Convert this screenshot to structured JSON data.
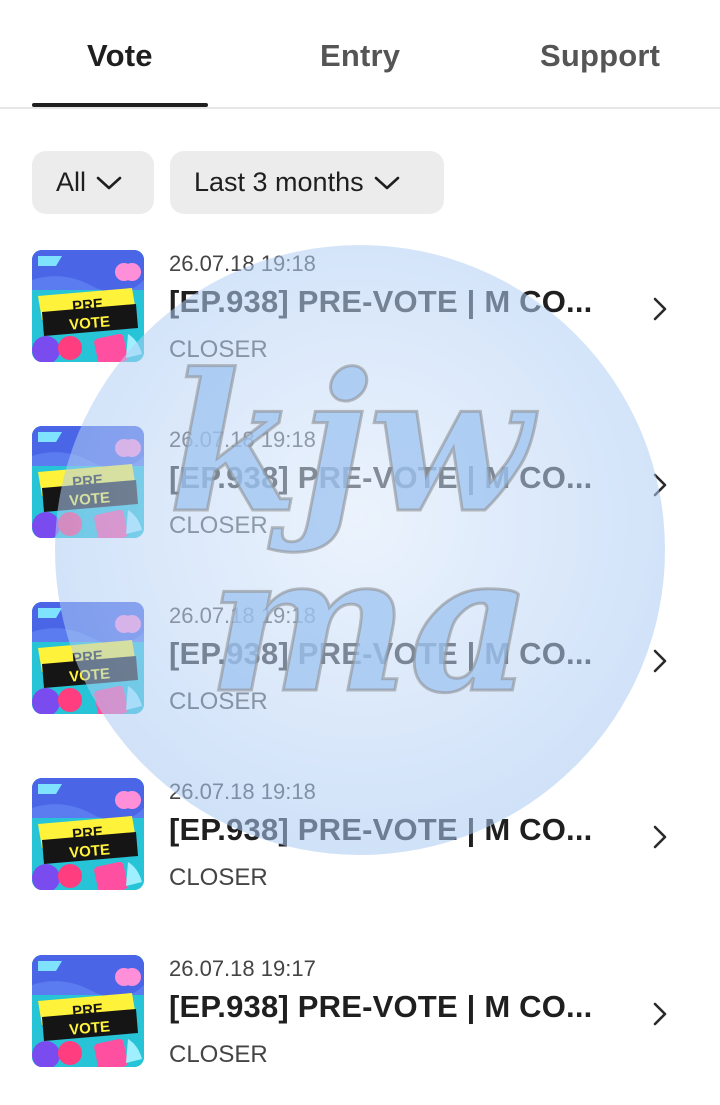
{
  "tabs": [
    {
      "label": "Vote",
      "active": true
    },
    {
      "label": "Entry",
      "active": false
    },
    {
      "label": "Support",
      "active": false
    }
  ],
  "filters": {
    "type": "All",
    "period": "Last 3 months"
  },
  "thumbnail_text": {
    "line1": "PRE",
    "line2": "VOTE"
  },
  "items": [
    {
      "date": "26.07.18",
      "time": "19:18",
      "title": "[EP.938] PRE-VOTE | M CO...",
      "artist": "CLOSER"
    },
    {
      "date": "26.07.18",
      "time": "19:18",
      "title": "[EP.938] PRE-VOTE | M CO...",
      "artist": "CLOSER"
    },
    {
      "date": "26.07.18",
      "time": "19:18",
      "title": "[EP.938] PRE-VOTE | M CO...",
      "artist": "CLOSER"
    },
    {
      "date": "26.07.18",
      "time": "19:18",
      "title": "[EP.938] PRE-VOTE | M CO...",
      "artist": "CLOSER"
    },
    {
      "date": "26.07.18",
      "time": "19:17",
      "title": "[EP.938] PRE-VOTE | M CO...",
      "artist": "CLOSER"
    }
  ],
  "watermark": {
    "text_line1": "kjw",
    "text_line2": "ma"
  },
  "colors": {
    "accent": "#1f1f1f",
    "chip_bg": "#ececec",
    "thumb_bg": "#27c4d7",
    "watermark": "#bcd6f7"
  }
}
